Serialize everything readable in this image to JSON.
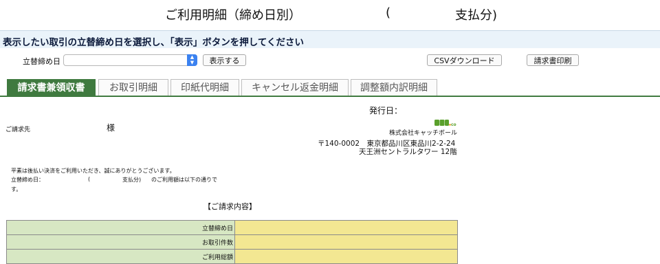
{
  "header": {
    "title": "ご利用明細（締め日別）",
    "paren_open": "(",
    "pay_suffix": "支払分)"
  },
  "instruction": "表示したい取引の立替締め日を選択し、「表示」ボタンを押してください",
  "controls": {
    "date_label": "立替締め日",
    "date_selected": "",
    "show_button": "表示する",
    "csv_button": "CSVダウンロード",
    "print_button": "請求書印刷"
  },
  "tabs": [
    {
      "label": "請求書兼領収書",
      "active": true
    },
    {
      "label": "お取引明細",
      "active": false
    },
    {
      "label": "印紙代明細",
      "active": false
    },
    {
      "label": "キャンセル返金明細",
      "active": false
    },
    {
      "label": "調整額内訳明細",
      "active": false
    }
  ],
  "invoice": {
    "issue_date_label": "発行日：",
    "billing_to_label": "ご請求先",
    "honorific": "様",
    "logo_text": "後払い.com",
    "company": "株式会社キャッチボール",
    "address1": "〒140-0002　東京都品川区東品川2-2-24",
    "address2": "天王洲セントラルタワー 12階",
    "message1": "平素は後払い決済をご利用いただき、誠にありがとうございます。",
    "message2": "立替締め日：",
    "message2_paren": "(",
    "message2_pay": "支払分)",
    "message2_rest": "のご利用額は以下の通りで",
    "message3": "す。",
    "section_title": "【ご請求内容】",
    "rows": [
      {
        "label": "立替締め日",
        "value": ""
      },
      {
        "label": "お取引件数",
        "value": ""
      },
      {
        "label": "ご利用総額",
        "value": ""
      }
    ]
  },
  "colors": {
    "tab_active": "#3f7a3f",
    "instruction_bg": "#eaf3fa",
    "label_cell": "#d7e7c3",
    "value_cell": "#f3e792",
    "logo_green": "#5aa02c"
  }
}
